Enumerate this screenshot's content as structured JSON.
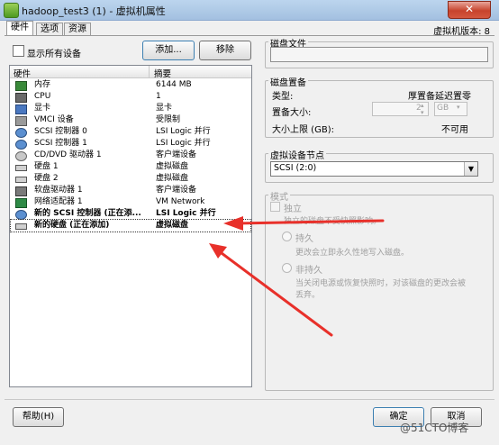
{
  "window": {
    "title": "hadoop_test3 (1) - 虚拟机属性",
    "close_glyph": "✕"
  },
  "tabs": [
    {
      "label": "硬件"
    },
    {
      "label": "选项"
    },
    {
      "label": "资源"
    }
  ],
  "version": "虚拟机版本: 8",
  "left": {
    "show_all_label": "显示所有设备",
    "add_label": "添加...",
    "remove_label": "移除",
    "col_hardware": "硬件",
    "col_summary": "摘要",
    "rows": [
      {
        "name": "内存",
        "summary": "6144 MB",
        "icon": "memory-icon"
      },
      {
        "name": "CPU",
        "summary": "1",
        "icon": "cpu-icon"
      },
      {
        "name": "显卡",
        "summary": "显卡",
        "icon": "display-icon"
      },
      {
        "name": "VMCI 设备",
        "summary": "受限制",
        "icon": "vmci-icon"
      },
      {
        "name": "SCSI 控制器 0",
        "summary": "LSI Logic 并行",
        "icon": "scsi-icon"
      },
      {
        "name": "SCSI 控制器 1",
        "summary": "LSI Logic 并行",
        "icon": "scsi-icon"
      },
      {
        "name": "CD/DVD 驱动器 1",
        "summary": "客户端设备",
        "icon": "cdrom-icon"
      },
      {
        "name": "硬盘 1",
        "summary": "虚拟磁盘",
        "icon": "harddisk-icon"
      },
      {
        "name": "硬盘 2",
        "summary": "虚拟磁盘",
        "icon": "harddisk-icon"
      },
      {
        "name": "软盘驱动器 1",
        "summary": "客户端设备",
        "icon": "floppy-icon"
      },
      {
        "name": "网络适配器 1",
        "summary": "VM Network",
        "icon": "network-icon"
      },
      {
        "name": "新的 SCSI 控制器 (正在添...",
        "summary": "LSI Logic 并行",
        "icon": "scsi-icon"
      },
      {
        "name": "新的硬盘 (正在添加)",
        "summary": "虚拟磁盘",
        "icon": "harddisk-icon"
      }
    ]
  },
  "right": {
    "disk_file_title": "磁盘文件",
    "provision_title": "磁盘置备",
    "type_label": "类型:",
    "type_value": "厚置备延迟置零",
    "size_label": "置备大小:",
    "size_value": "2",
    "size_unit": "GB",
    "max_label": "大小上限 (GB):",
    "max_value": "不可用",
    "node_title": "虚拟设备节点",
    "node_value": "SCSI (2:0)",
    "mode_title": "模式",
    "independent_label": "独立",
    "independent_desc": "独立的磁盘不受快照影响。",
    "persistent_label": "持久",
    "persistent_desc": "更改会立即永久性地写入磁盘。",
    "nonpersistent_label": "非持久",
    "nonpersistent_desc_1": "当关闭电源或恢复快照时，对该磁盘的更改会被",
    "nonpersistent_desc_2": "丢弃。"
  },
  "footer": {
    "help_label": "帮助(H)",
    "ok_label": "确定",
    "cancel_label": "取消"
  },
  "watermark": "@51CTO博客",
  "colors": {
    "arrow": "#e8302a",
    "title_bar": "#b4cde9"
  }
}
